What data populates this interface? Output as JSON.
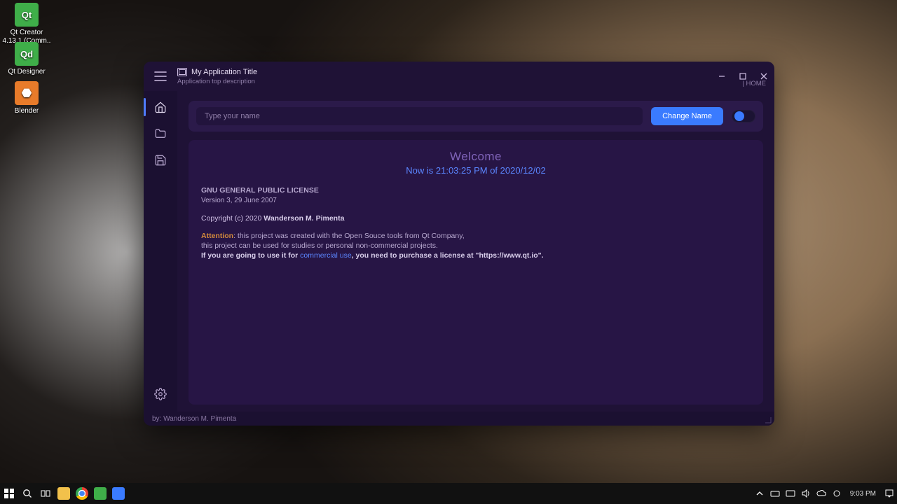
{
  "desktop_icons": [
    {
      "label": "Qt Creator 4.13.1 (Comm..",
      "bg": "#3fae49",
      "text": "Qt"
    },
    {
      "label": "Qt Designer",
      "bg": "#3fae49",
      "text": "Qd"
    },
    {
      "label": "Blender",
      "bg": "#e87b2a",
      "text": "◆"
    }
  ],
  "window": {
    "title": "My Application Title",
    "description": "Application top description",
    "breadcrumb": "| HOME",
    "footer": "by: Wanderson M. Pimenta"
  },
  "input": {
    "placeholder": "Type your name",
    "button": "Change Name"
  },
  "content": {
    "welcome": "Welcome",
    "now_prefix": "Now is ",
    "now_time": "21:03:25 PM of 2020/12/02",
    "gpl_title": "GNU GENERAL PUBLIC LICENSE",
    "gpl_version": "Version 3, 29 June 2007",
    "copyright_prefix": "Copyright (c) 2020 ",
    "copyright_name": "Wanderson M. Pimenta",
    "attention_label": "Attention",
    "attention_1": ": this project was created with the Open Souce tools from Qt Company,",
    "attention_2": "this project can be used for studies or personal non-commercial projects.",
    "attention_3a": "If you are going to use it for ",
    "attention_3b": "commercial use",
    "attention_3c": ", you need to purchase a license at \"https://www.qt.io\"."
  },
  "taskbar": {
    "clock": "9:03 PM"
  },
  "colors": {
    "accent": "#3a7bff",
    "panel": "#271545",
    "app_bg": "#1f1236"
  }
}
